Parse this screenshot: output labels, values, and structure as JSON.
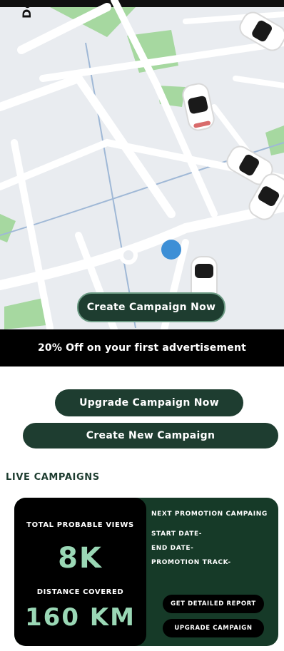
{
  "map": {
    "label": "Do",
    "create_campaign_label": "Create Campaign Now"
  },
  "promo": {
    "text": "20% Off on your first advertisement"
  },
  "actions": {
    "upgrade_label": "Upgrade Campaign Now",
    "create_new_label": "Create New Campaign"
  },
  "live": {
    "heading": "LIVE CAMPAIGNS",
    "stats": {
      "views_label": "TOTAL PROBABLE VIEWS",
      "views_value": "8K",
      "distance_label": "DISTANCE COVERED",
      "distance_value": "160 KM"
    },
    "info": {
      "next_promotion": "NEXT PROMOTION CAMPAING",
      "start_date": "START DATE-",
      "end_date": "END DATE-",
      "promotion_track": "PROMOTION TRACK-"
    },
    "buttons": {
      "report": "GET DETAILED REPORT",
      "upgrade": "UPGRADE CAMPAIGN"
    }
  },
  "colors": {
    "brand_dark_green": "#1e3d30",
    "accent_mint": "#9ad7b5",
    "map_bg": "#e9ecf0",
    "park_green": "#a6d8a0",
    "location_blue": "#3d8fd6"
  }
}
